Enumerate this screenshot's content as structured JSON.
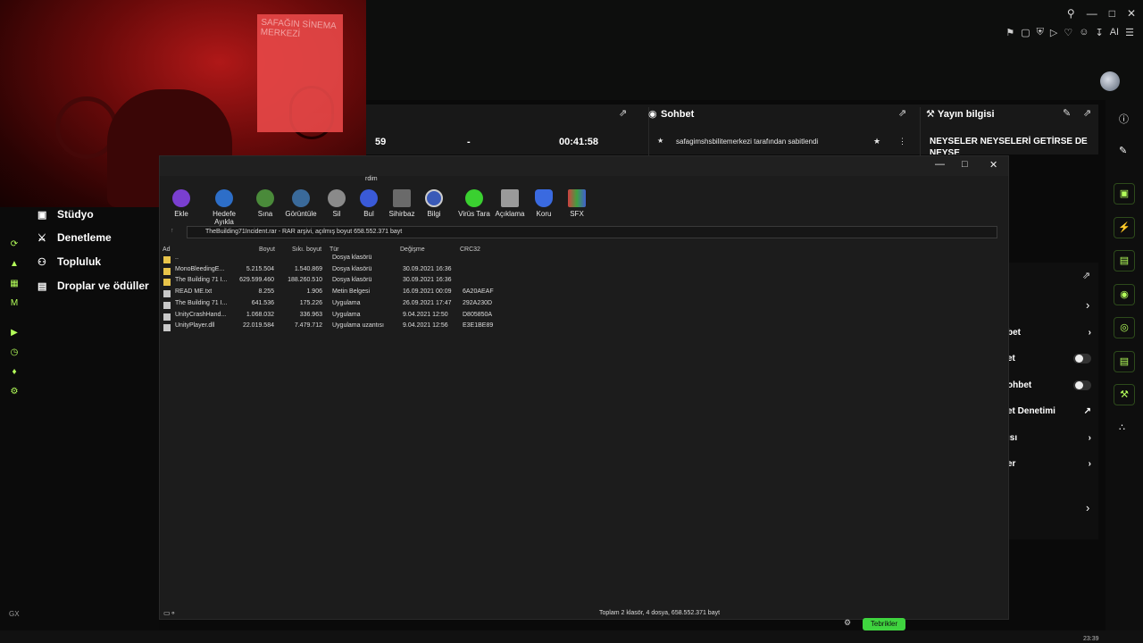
{
  "colors": {
    "accent": "#b4ff5a",
    "panel": "#181818",
    "pill": "#3fd43f"
  },
  "header": {
    "num_viewers": "59",
    "dash": "-",
    "duration": "00:41:58",
    "chat_title": "Sohbet",
    "stream_info_title": "Yayın bilgisi",
    "pinned_msg": "safagimshsbilitemerkezi tarafından sabitlendi",
    "stream_title_line1": "NEYSELER NEYSELERİ GETİRSE DE",
    "stream_title_line2": "NEYSE",
    "stream_extra": "et"
  },
  "webcam": {
    "sign_text": "SAFAĞIN SİNEMA MERKEZİ"
  },
  "nav": {
    "items": [
      {
        "label": "Stüdyo",
        "icon": "studio-icon"
      },
      {
        "label": "Denetleme",
        "icon": "sword-icon"
      },
      {
        "label": "Topluluk",
        "icon": "people-icon"
      },
      {
        "label": "Droplar ve ödüller",
        "icon": "gift-icon"
      }
    ]
  },
  "right_panel": {
    "rows": [
      {
        "label": "bet"
      },
      {
        "label": "et"
      },
      {
        "label": "ohbet"
      },
      {
        "label": "et Denetimi"
      },
      {
        "label": "ısı"
      },
      {
        "label": "er"
      }
    ]
  },
  "winrar": {
    "title_fragment": "rdim",
    "toolbar": [
      "Ekle",
      "Hedefe Ayıkla",
      "Sına",
      "Görüntüle",
      "Sil",
      "Bul",
      "Sihirbaz",
      "Bilgi",
      "Virüs Tara",
      "Açıklama",
      "Koru",
      "SFX"
    ],
    "path": "TheBuilding71Incident.rar - RAR arşivi, açılmış boyut 658.552.371 bayt",
    "columns": [
      "Ad",
      "Boyut",
      "Sıkı. boyut",
      "Tür",
      "Değişme",
      "CRC32"
    ],
    "files": [
      {
        "name": "..",
        "size": "",
        "packed": "",
        "type": "Dosya klasörü",
        "modified": "",
        "crc": ""
      },
      {
        "name": "MonoBleedingE...",
        "size": "5.215.504",
        "packed": "1.540.869",
        "type": "Dosya klasörü",
        "modified": "30.09.2021 16:36",
        "crc": ""
      },
      {
        "name": "The Building 71 I...",
        "size": "629.599.460",
        "packed": "188.260.510",
        "type": "Dosya klasörü",
        "modified": "30.09.2021 16:36",
        "crc": ""
      },
      {
        "name": "READ ME.txt",
        "size": "8.255",
        "packed": "1.906",
        "type": "Metin Belgesi",
        "modified": "16.09.2021 00:09",
        "crc": "6A20AEAF"
      },
      {
        "name": "The Building 71 I...",
        "size": "641.536",
        "packed": "175.226",
        "type": "Uygulama",
        "modified": "26.09.2021 17:47",
        "crc": "292A230D"
      },
      {
        "name": "UnityCrashHand...",
        "size": "1.068.032",
        "packed": "336.963",
        "type": "Uygulama",
        "modified": "9.04.2021 12:50",
        "crc": "D805850A"
      },
      {
        "name": "UnityPlayer.dll",
        "size": "22.019.584",
        "packed": "7.479.712",
        "type": "Uygulama uzantısı",
        "modified": "9.04.2021 12:56",
        "crc": "E3E1BE89"
      }
    ],
    "status": "Toplam 2 klasör, 4 dosya, 658.552.371 bayt"
  },
  "bottom": {
    "green_pill": "Tebrikler",
    "clock": "23:39",
    "left_mark": "GX"
  }
}
